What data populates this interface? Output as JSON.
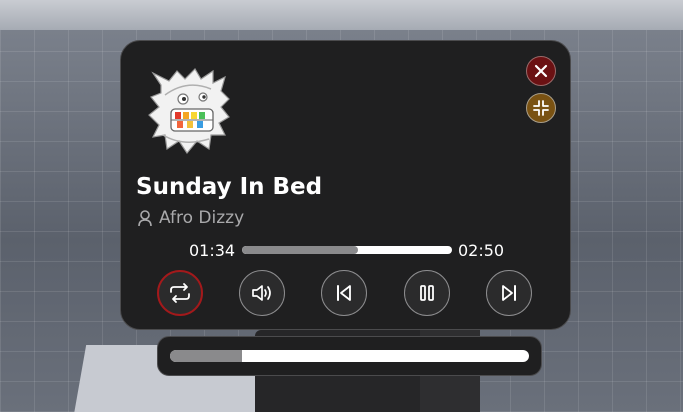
{
  "track": {
    "title": "Sunday In Bed",
    "artist": "Afro Dizzy"
  },
  "playback": {
    "current_time": "01:34",
    "total_time": "02:50",
    "progress": 0.55,
    "volume": 0.2,
    "repeat_active": true
  },
  "icons": {
    "close": "close-icon",
    "minimize": "minimize-icon",
    "artist": "person-icon",
    "repeat": "repeat-icon",
    "volume": "speaker-icon",
    "previous": "skip-previous-icon",
    "pause": "pause-icon",
    "next": "skip-next-icon"
  },
  "colors": {
    "panel": "#1f1f20",
    "close_button": "#6b1113",
    "minimize_button": "#7a5212",
    "active_ring": "#a3191b",
    "progress_track": "#ffffff",
    "progress_fill": "#8a8a8c"
  }
}
